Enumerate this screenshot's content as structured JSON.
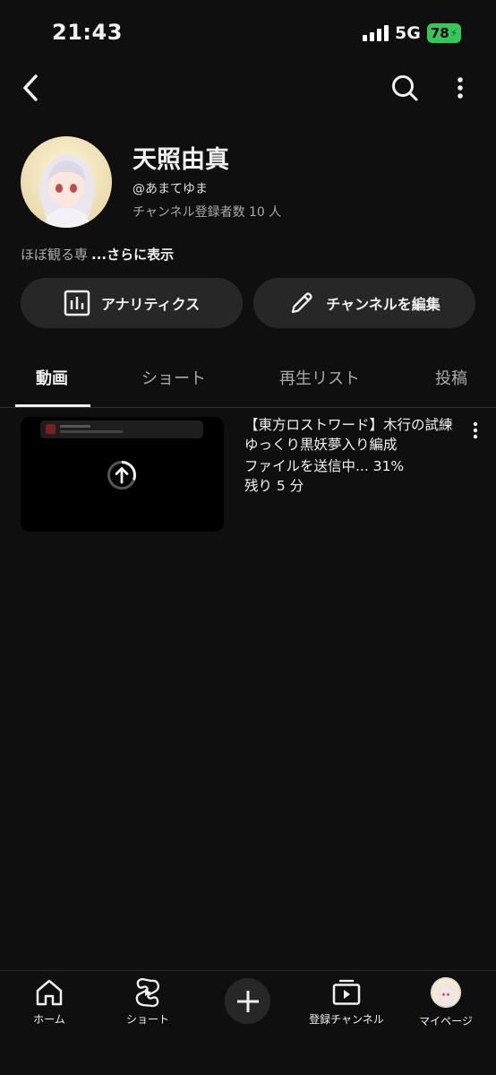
{
  "status_bar": {
    "time": "21:43",
    "network": "5G",
    "battery": "78"
  },
  "channel": {
    "name": "天照由真",
    "handle": "@あまてゆま",
    "subscribers": "チャンネル登録者数 10 人",
    "description": "ほぼ観る専",
    "show_more": "...さらに表示"
  },
  "actions": {
    "analytics": "アナリティクス",
    "edit_channel": "チャンネルを編集"
  },
  "tabs": [
    {
      "label": "動画"
    },
    {
      "label": "ショート"
    },
    {
      "label": "再生リスト"
    },
    {
      "label": "投稿"
    }
  ],
  "video": {
    "title": "【東方ロストワード】木行の試練ゆっくり黒妖夢入り編成",
    "upload_status": "ファイルを送信中... 31%",
    "time_left": "残り 5 分",
    "progress_percent": 31
  },
  "bottom_nav": [
    {
      "label": "ホーム",
      "icon": "home-icon"
    },
    {
      "label": "ショート",
      "icon": "shorts-icon"
    },
    {
      "label": "",
      "icon": "plus-icon"
    },
    {
      "label": "登録チャンネル",
      "icon": "subscriptions-icon"
    },
    {
      "label": "マイページ",
      "icon": "avatar"
    }
  ]
}
